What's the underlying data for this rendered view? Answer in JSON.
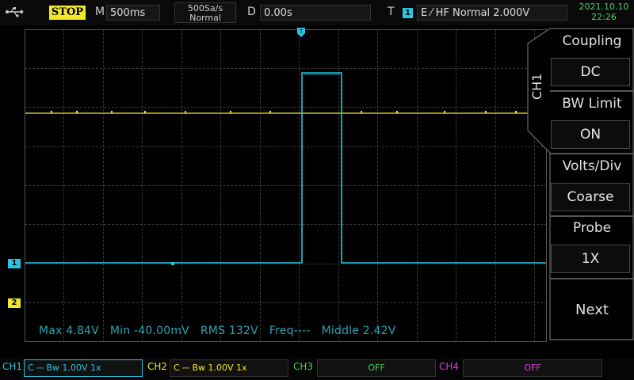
{
  "status": {
    "run_state": "STOP"
  },
  "timebase": {
    "label": "M",
    "value": "500ms"
  },
  "acquisition": {
    "sample_rate": "500Sa/s",
    "mode": "Normal"
  },
  "delay": {
    "label": "D",
    "value": "0.00s"
  },
  "trigger": {
    "label": "T",
    "source": "1",
    "info": "E ⁄ HF Normal 2.000V"
  },
  "clock": {
    "date": "2021.10.10",
    "time": "22:26"
  },
  "markers": {
    "ch1": "1",
    "ch2": "2",
    "trigger_top": "T"
  },
  "measurements": "Max 4.84V   Min -40.00mV   RMS 132V   Freq----   Middle 2.42V",
  "menu": {
    "channel_tab": "CH1",
    "items": [
      {
        "title": "Coupling",
        "value": "DC"
      },
      {
        "title": "BW  Limit",
        "value": "ON"
      },
      {
        "title": "Volts/Div",
        "value": "Coarse"
      },
      {
        "title": "Probe",
        "value": "1X"
      }
    ],
    "next": "Next"
  },
  "channels": [
    {
      "name": "CH1",
      "settings": "C ⎓ Bw 1.00V 1x"
    },
    {
      "name": "CH2",
      "settings": "C ⎓ Bw 1.00V 1x"
    },
    {
      "name": "CH3",
      "settings": "OFF"
    },
    {
      "name": "CH4",
      "settings": "OFF"
    }
  ],
  "colors": {
    "ch1": "#27c6e0",
    "ch2": "#f2e82a",
    "ch3": "#46d35a",
    "ch4": "#d63fd6"
  }
}
